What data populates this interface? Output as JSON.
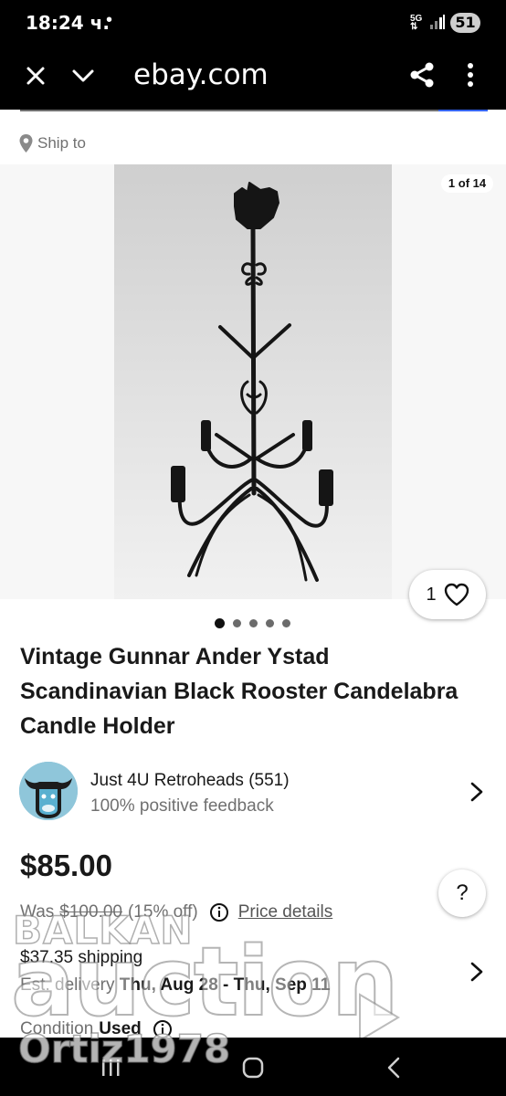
{
  "status_bar": {
    "time": "18:24 ч.",
    "dot": "•",
    "network": "5G",
    "battery": "51"
  },
  "browser": {
    "url": "ebay.com"
  },
  "ship_to": {
    "label": "Ship to"
  },
  "gallery": {
    "counter": "1 of 14",
    "watch_count": "1",
    "total_dots": 5,
    "active_dot": 0
  },
  "listing": {
    "title": "Vintage Gunnar Ander Ystad Scandinavian Black Rooster Candelabra Candle Holder",
    "price": "$85.00",
    "was_label": "Was",
    "was_price": "$100.00",
    "discount": "(15% off)",
    "price_details": "Price details",
    "shipping": "$37.35 shipping",
    "delivery_label": "Est. delivery",
    "delivery_dates": "Thu, Aug 28 - Thu, Sep 11",
    "condition_label": "Condition",
    "condition_value": "Used"
  },
  "seller": {
    "name": "Just 4U Retroheads (551)",
    "feedback": "100% positive feedback"
  },
  "help": {
    "label": "?"
  },
  "watermark": {
    "top": "BALKAN",
    "main": "auction",
    "user": "Ortiz1978"
  },
  "colors": {
    "accent": "#3665f3",
    "secondary_text": "#707070",
    "text": "#191919"
  }
}
